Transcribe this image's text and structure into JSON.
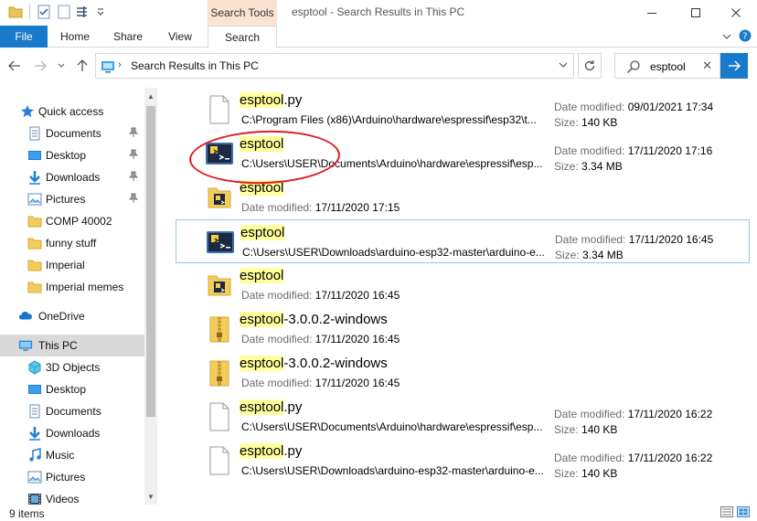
{
  "window": {
    "title": "esptool - Search Results in This PC",
    "context_tab": "Search Tools"
  },
  "ribbon": {
    "tabs": [
      "File",
      "Home",
      "Share",
      "View",
      "Search"
    ]
  },
  "address": {
    "breadcrumb": "Search Results in This PC"
  },
  "search": {
    "value": "esptool"
  },
  "nav": {
    "quick_access": "Quick access",
    "pinned": [
      "Documents",
      "Desktop",
      "Downloads",
      "Pictures"
    ],
    "folders": [
      "COMP 40002",
      "funny stuff",
      "Imperial",
      "Imperial memes"
    ],
    "onedrive": "OneDrive",
    "this_pc": "This PC",
    "pc_items": [
      "3D Objects",
      "Desktop",
      "Documents",
      "Downloads",
      "Music",
      "Pictures",
      "Videos"
    ]
  },
  "labels": {
    "date_modified": "Date modified:",
    "size": "Size:"
  },
  "results": [
    {
      "hl": "esptool",
      "rest": ".py",
      "icon": "file-icon",
      "path": "C:\\Program Files (x86)\\Arduino\\hardware\\espressif\\esp32\\t...",
      "date": "09/01/2021 17:34",
      "size": "140 KB"
    },
    {
      "hl": "esptool",
      "rest": "",
      "icon": "python-app-icon",
      "path": "C:\\Users\\USER\\Documents\\Arduino\\hardware\\espressif\\esp...",
      "date": "17/11/2020 17:16",
      "size": "3.34 MB"
    },
    {
      "hl": "esptool",
      "rest": "",
      "icon": "folder-python-icon",
      "path": "",
      "date": "17/11/2020 17:15",
      "size": ""
    },
    {
      "hl": "esptool",
      "rest": "",
      "icon": "python-app-icon",
      "path": "C:\\Users\\USER\\Downloads\\arduino-esp32-master\\arduino-e...",
      "date": "17/11/2020 16:45",
      "size": "3.34 MB"
    },
    {
      "hl": "esptool",
      "rest": "",
      "icon": "folder-python-icon",
      "path": "",
      "date": "17/11/2020 16:45",
      "size": ""
    },
    {
      "hl": "esptool",
      "rest": "-3.0.0.2-windows",
      "icon": "zip-folder-icon",
      "path": "",
      "date": "17/11/2020 16:45",
      "size": ""
    },
    {
      "hl": "esptool",
      "rest": "-3.0.0.2-windows",
      "icon": "zip-folder-icon",
      "path": "",
      "date": "17/11/2020 16:45",
      "size": ""
    },
    {
      "hl": "esptool",
      "rest": ".py",
      "icon": "file-icon",
      "path": "C:\\Users\\USER\\Documents\\Arduino\\hardware\\espressif\\esp...",
      "date": "17/11/2020 16:22",
      "size": "140 KB"
    },
    {
      "hl": "esptool",
      "rest": ".py",
      "icon": "file-icon",
      "path": "C:\\Users\\USER\\Downloads\\arduino-esp32-master\\arduino-e...",
      "date": "17/11/2020 16:22",
      "size": "140 KB"
    }
  ],
  "status": {
    "count": "9 items"
  },
  "colors": {
    "accent": "#1979ca",
    "highlight": "#ffff9c",
    "context_tab": "#fbe3d2",
    "annotation": "#e01b24"
  }
}
